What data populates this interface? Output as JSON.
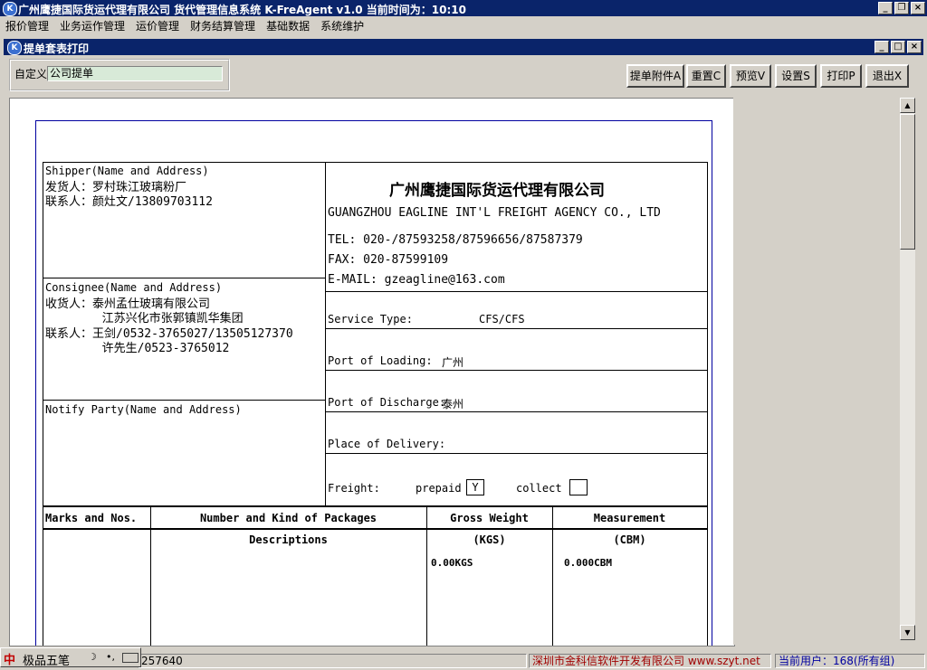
{
  "app": {
    "title": "广州鹰捷国际货运代理有限公司  货代管理信息系统 K-FreAgent v1.0  当前时间为：10:10"
  },
  "menu": [
    "报价管理",
    "业务运作管理",
    "运价管理",
    "财务结算管理",
    "基础数据",
    "系统维护"
  ],
  "child": {
    "title": "提单套表打印"
  },
  "filter": {
    "label": "自定义",
    "value": "公司提单"
  },
  "toolbar": {
    "attachment": "提单附件A",
    "reset": "重置C",
    "preview": "预览V",
    "settings": "设置S",
    "print": "打印P",
    "exit": "退出X"
  },
  "bl": {
    "shipper_header": "Shipper(Name and Address)",
    "shipper_line1": "发货人：罗村珠江玻璃粉厂",
    "shipper_line2": "联系人：颜灶文/13809703112",
    "consignee_header": "Consignee(Name and Address)",
    "consignee_line1": "收货人：泰州孟仕玻璃有限公司",
    "consignee_line2": "        江苏兴化市张郭镇凯华集团",
    "consignee_line3": "联系人：王剑/0532-3765027/13505127370",
    "consignee_line4": "        许先生/0523-3765012",
    "notify_header": "Notify Party(Name and Address)",
    "company_cn": "广州鹰捷国际货运代理有限公司",
    "company_en": "GUANGZHOU EAGLINE INT'L FREIGHT AGENCY CO., LTD",
    "tel": "TEL: 020-/87593258/87596656/87587379",
    "fax": "FAX: 020-87599109",
    "email": "E-MAIL: gzeagline@163.com",
    "service_type_label": "Service Type:",
    "service_type_value": "CFS/CFS",
    "pol_label": "Port of Loading:",
    "pol_value": "广州",
    "pod_label": "Port of Discharge:",
    "pod_value": "泰州",
    "delivery_label": "Place of Delivery:",
    "freight_label": "Freight:",
    "prepaid_label": "prepaid",
    "prepaid_value": "Y",
    "collect_label": "collect",
    "collect_value": "",
    "col_marks": "Marks and Nos.",
    "col_packages": "Number and Kind of Packages",
    "col_gross": "Gross Weight",
    "col_measure": "Measurement",
    "col_desc": "Descriptions",
    "col_kgs": "(KGS)",
    "col_cbm": "(CBM)",
    "gross_value": "0.00KGS",
    "measure_value": "0.000CBM"
  },
  "status": {
    "left": "257640",
    "company": "深圳市金科信软件开发有限公司 www.szyt.net",
    "user": "当前用户：168(所有组)"
  },
  "ime": {
    "name": "极品五笔"
  }
}
